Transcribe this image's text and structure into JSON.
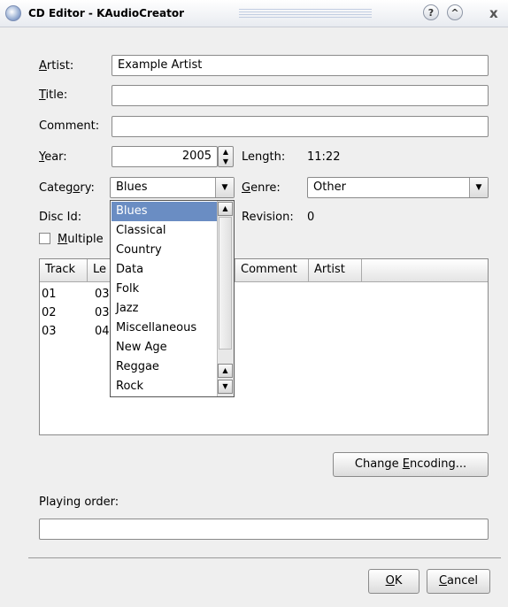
{
  "window": {
    "title": "CD Editor - KAudioCreator",
    "help_label": "?",
    "shade_label": "^",
    "close_label": "x"
  },
  "form": {
    "artist_label_u": "A",
    "artist_label_rest": "rtist:",
    "artist_value": "Example Artist",
    "title_label_u": "T",
    "title_label_rest": "itle:",
    "title_value": "",
    "comment_label": "Comment:",
    "comment_value": "",
    "year_label_u": "Y",
    "year_label_rest": "ear:",
    "year_value": "2005",
    "length_label": "Length:",
    "length_value": "11:22",
    "category_label_pre": "Categ",
    "category_label_u": "o",
    "category_label_post": "ry:",
    "category_value": "Blues",
    "genre_label_u": "G",
    "genre_label_rest": "enre:",
    "genre_value": "Other",
    "discid_label": "Disc Id:",
    "revision_label": "Revision:",
    "revision_value": "0",
    "multiple_label_u": "M",
    "multiple_label_rest": "ultiple"
  },
  "table": {
    "headers": [
      "Track",
      "Le",
      "Comment",
      "Artist"
    ],
    "rows": [
      {
        "track": "01",
        "length": "03"
      },
      {
        "track": "02",
        "length": "03"
      },
      {
        "track": "03",
        "length": "04"
      }
    ]
  },
  "category_dropdown": {
    "options": [
      "Blues",
      "Classical",
      "Country",
      "Data",
      "Folk",
      "Jazz",
      "Miscellaneous",
      "New Age",
      "Reggae",
      "Rock"
    ],
    "selected": "Blues"
  },
  "buttons": {
    "change_encoding_pre": "Change ",
    "change_encoding_u": "E",
    "change_encoding_post": "ncoding...",
    "ok_u": "O",
    "ok_rest": "K",
    "cancel_u": "C",
    "cancel_rest": "ancel"
  },
  "playing_order": {
    "label": "Playing order:",
    "value": ""
  }
}
